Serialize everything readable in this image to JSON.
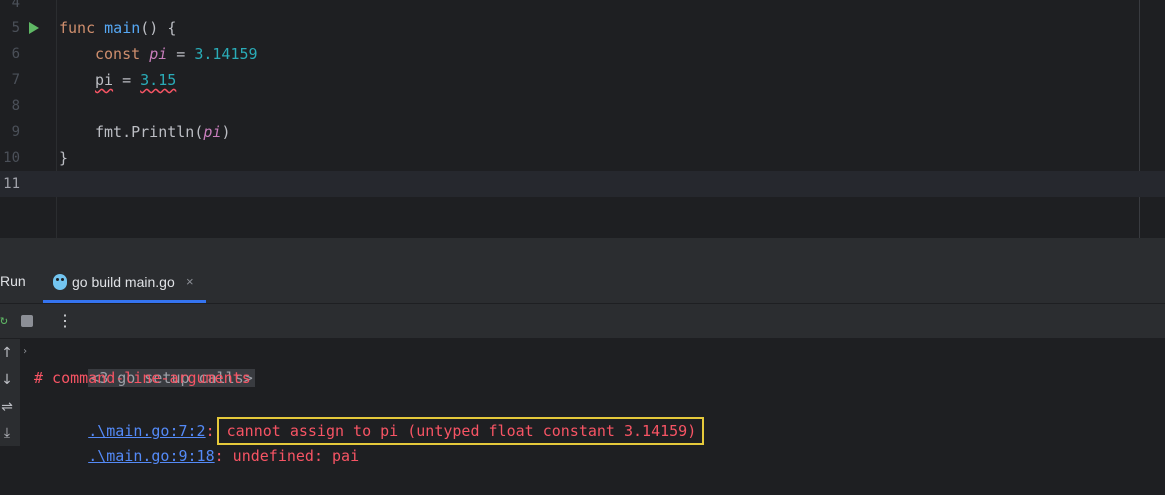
{
  "editor": {
    "lines": [
      {
        "num": "4"
      },
      {
        "num": "5"
      },
      {
        "num": "6"
      },
      {
        "num": "7"
      },
      {
        "num": "8"
      },
      {
        "num": "9"
      },
      {
        "num": "10"
      },
      {
        "num": "11"
      }
    ],
    "code": {
      "func_kw": "func",
      "main_name": "main",
      "main_rest": "() {",
      "const_kw": "const",
      "pi_var": "pi",
      "eq": " = ",
      "pi_value": "3.14159",
      "assign_var": "pi",
      "assign_eq": " = ",
      "assign_value": "3.15",
      "println_prefix": "fmt.",
      "println_name": "Println",
      "paren_open": "(",
      "println_arg": "pi",
      "paren_close": ")",
      "close_brace": "}"
    }
  },
  "run_panel": {
    "title": "Run",
    "tab_label": "go build main.go",
    "tab_close": "×",
    "more_label": "⋮"
  },
  "console": {
    "collapsed_calls": "<3 go setup calls>",
    "comment_line": "# command-line-arguments",
    "error1_location": ".\\main.go:7:2",
    "error1_sep": ":",
    "error1_message": "cannot assign to pi (untyped float constant 3.14159)",
    "error2_location": ".\\main.go:9:18",
    "error2_message": ": undefined: pai"
  },
  "colors": {
    "highlight_border": "#e5c93b",
    "error_text": "#f75464",
    "link": "#548af7"
  }
}
